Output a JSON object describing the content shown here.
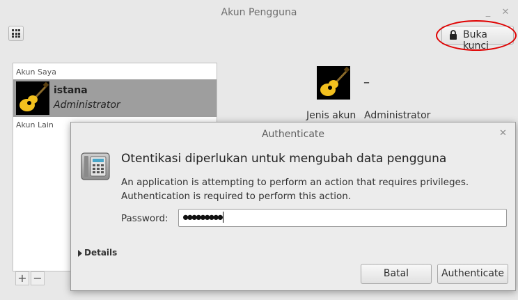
{
  "window": {
    "title": "Akun Pengguna"
  },
  "toolbar": {
    "unlock_label": "Buka kunci"
  },
  "user_list": {
    "my_account_header": "Akun Saya",
    "other_accounts_header": "Akun Lain",
    "users": [
      {
        "name": "istana",
        "role": "Administrator"
      }
    ],
    "add_symbol": "+",
    "remove_symbol": "−"
  },
  "details": {
    "name_value": "–",
    "account_type_label": "Jenis akun",
    "account_type_value": "Administrator"
  },
  "dialog": {
    "title": "Authenticate",
    "heading": "Otentikasi diperlukan untuk mengubah data pengguna",
    "message_line1": "An application is attempting to perform an action that requires privileges.",
    "message_line2": "Authentication is required to perform this action.",
    "password_label": "Password:",
    "password_mask": "●●●●●●●●●",
    "details_label": "Details",
    "cancel_label": "Batal",
    "confirm_label": "Authenticate"
  },
  "icons": {
    "close": "close-icon",
    "minimize": "minimize-icon",
    "menu": "grid-menu-icon",
    "lock": "lock-icon",
    "avatar": "guitar-icon",
    "auth": "keypad-lock-icon"
  },
  "colors": {
    "selection": "#9e9e9e",
    "highlight_ring": "#e00000"
  }
}
